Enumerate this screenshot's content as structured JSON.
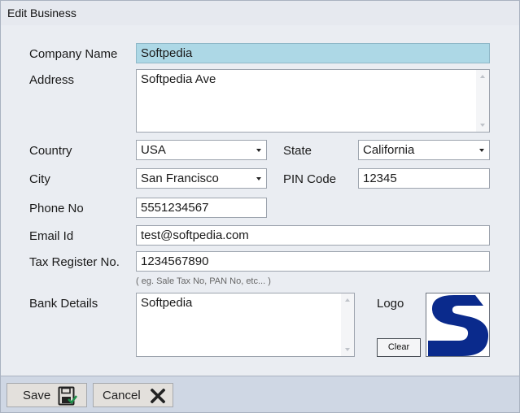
{
  "window": {
    "title": "Edit Business"
  },
  "form": {
    "company_name_label": "Company Name",
    "company_name_value": "Softpedia",
    "address_label": "Address",
    "address_value": "Softpedia Ave",
    "country_label": "Country",
    "country_value": "USA",
    "state_label": "State",
    "state_value": "California",
    "city_label": "City",
    "city_value": "San Francisco",
    "pin_label": "PIN Code",
    "pin_value": "12345",
    "phone_label": "Phone No",
    "phone_value": "5551234567",
    "email_label": "Email Id",
    "email_value": "test@softpedia.com",
    "tax_label": "Tax Register No.",
    "tax_value": "1234567890",
    "tax_hint": "( eg.  Sale Tax No, PAN No, etc... )",
    "bank_label": "Bank Details",
    "bank_value": "Softpedia",
    "logo_label": "Logo",
    "clear_label": "Clear"
  },
  "footer": {
    "save_label": "Save",
    "cancel_label": "Cancel"
  },
  "icons": {
    "save": "save-disk-icon",
    "cancel": "x-close-icon",
    "logo": "softpedia-s-logo"
  },
  "colors": {
    "highlight": "#add8e6",
    "logo_blue": "#0a2a8c",
    "footer_bg": "#cfd7e4"
  }
}
